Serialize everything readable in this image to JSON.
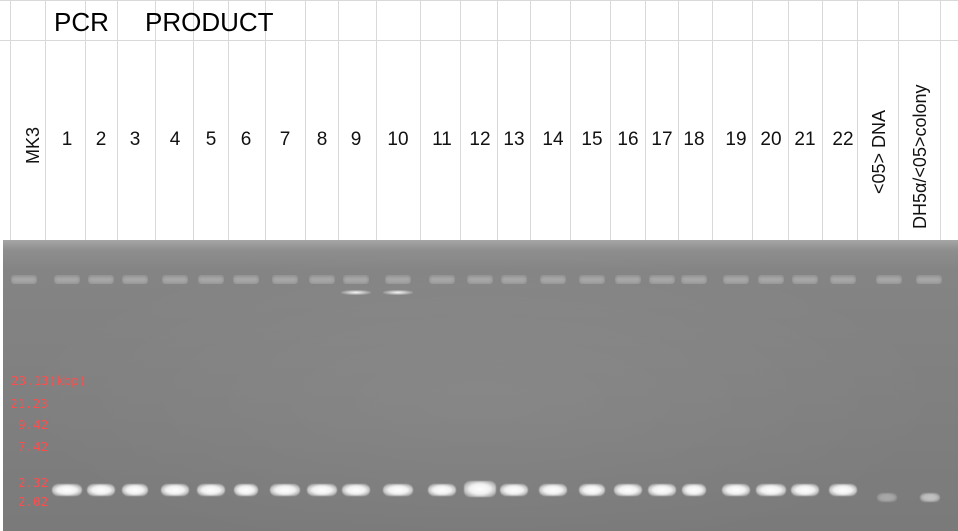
{
  "title": {
    "word1": "PCR",
    "word2": "PRODUCT"
  },
  "header": {
    "marker_label": "MK3",
    "lanes": [
      "1",
      "2",
      "3",
      "4",
      "5",
      "6",
      "7",
      "8",
      "9",
      "10",
      "11",
      "12",
      "13",
      "14",
      "15",
      "16",
      "17",
      "18",
      "19",
      "20",
      "21",
      "22"
    ],
    "control_1": "<05> DNA",
    "control_2": "DH5α/<05>colony"
  },
  "ladder": {
    "labels": [
      "23.13(kbp)",
      "21.23",
      "9.42",
      "7.42",
      "2.32",
      "2.02"
    ],
    "color": "#ff4d4d"
  },
  "gel": {
    "background": "#808080",
    "band_color": "#ffffff"
  }
}
